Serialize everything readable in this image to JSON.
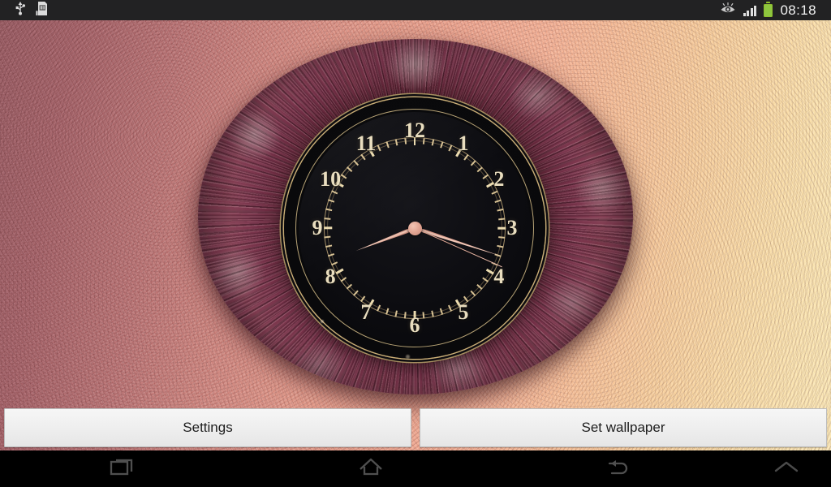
{
  "statusbar": {
    "time": "08:18",
    "left_icons": [
      {
        "name": "usb-icon",
        "label": "USB connected"
      },
      {
        "name": "sd-card-icon",
        "label": "SD card"
      }
    ],
    "right_icons": [
      {
        "name": "smart-stay-eye-icon",
        "label": "Smart stay"
      },
      {
        "name": "signal-bars-icon",
        "label": "Signal strength 4 bars"
      },
      {
        "name": "battery-icon",
        "label": "Battery full"
      }
    ],
    "background_color": "#222223",
    "text_color": "#f2f2f2",
    "battery_color": "#8ec63f"
  },
  "wallpaper": {
    "title": "Fur Wall Clock Live Wallpaper",
    "wall_color_left": "#9d6269",
    "wall_color_mid": "#f0ad98",
    "wall_color_right": "#fbe9bb",
    "fur_color_dark": "#3d1722",
    "fur_color_light": "#c4b0b0"
  },
  "clock": {
    "displayed_time": "08:18",
    "hour_angle_deg": 249,
    "minute_angle_deg": 108,
    "second_angle_deg": 114,
    "numerals": [
      "12",
      "1",
      "2",
      "3",
      "4",
      "5",
      "6",
      "7",
      "8",
      "9",
      "10",
      "11"
    ],
    "face_color": "#0c0c10",
    "numeral_color": "#e9ddbe",
    "bezel_color": "#c9ae76",
    "hand_color": "#e7b2a0",
    "hub_color": "#e2a694"
  },
  "buttons": {
    "settings_label": "Settings",
    "set_wallpaper_label": "Set wallpaper",
    "background_color": "#efefef",
    "text_color": "#1d1d1d"
  },
  "navbar": {
    "items": [
      {
        "name": "recents-button",
        "label": "Recent apps"
      },
      {
        "name": "home-button",
        "label": "Home"
      },
      {
        "name": "back-button",
        "label": "Back"
      },
      {
        "name": "expand-chevron-button",
        "label": "Show navigation"
      }
    ],
    "background_color": "#000000",
    "icon_color": "#4a4a4a"
  }
}
